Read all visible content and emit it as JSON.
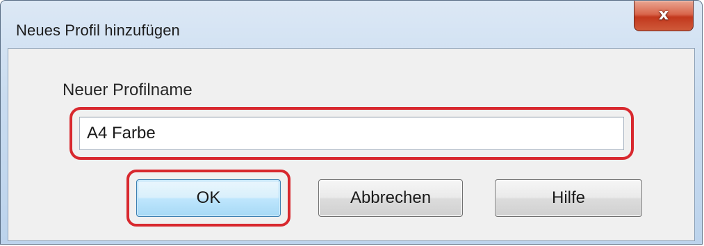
{
  "dialog": {
    "title": "Neues Profil hinzufügen",
    "close_icon": "close-x-icon",
    "close_glyph": "x"
  },
  "form": {
    "label": "Neuer Profilname",
    "profile_name_value": "A4 Farbe"
  },
  "buttons": {
    "ok": "OK",
    "cancel": "Abbrechen",
    "help": "Hilfe"
  },
  "colors": {
    "highlight": "#d8282e",
    "close_button": "#c2381d",
    "default_button": "#bee6fd"
  }
}
